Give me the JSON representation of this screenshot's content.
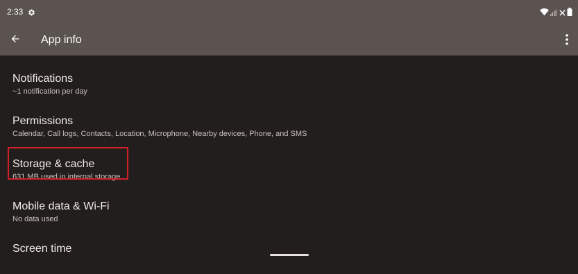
{
  "status_bar": {
    "time": "2:33",
    "left_icon": "gear-icon",
    "right_icons": [
      "wifi-icon",
      "signal-icon",
      "no-signal-x-icon",
      "battery-icon"
    ]
  },
  "app_bar": {
    "back_icon": "arrow-left-icon",
    "title": "App info",
    "more_icon": "more-vert-icon"
  },
  "items": [
    {
      "title": "Notifications",
      "subtitle": "~1 notification per day"
    },
    {
      "title": "Permissions",
      "subtitle": "Calendar, Call logs, Contacts, Location, Microphone, Nearby devices, Phone, and SMS"
    },
    {
      "title": "Storage & cache",
      "subtitle": "631 MB used in internal storage",
      "highlighted": true
    },
    {
      "title": "Mobile data & Wi-Fi",
      "subtitle": "No data used"
    },
    {
      "title": "Screen time",
      "subtitle": ""
    }
  ],
  "colors": {
    "background": "#221e1d",
    "app_bar": "#5a5350",
    "highlight": "#d0202a",
    "primary_text": "#f2ecea",
    "secondary_text": "#c9c2bf"
  }
}
